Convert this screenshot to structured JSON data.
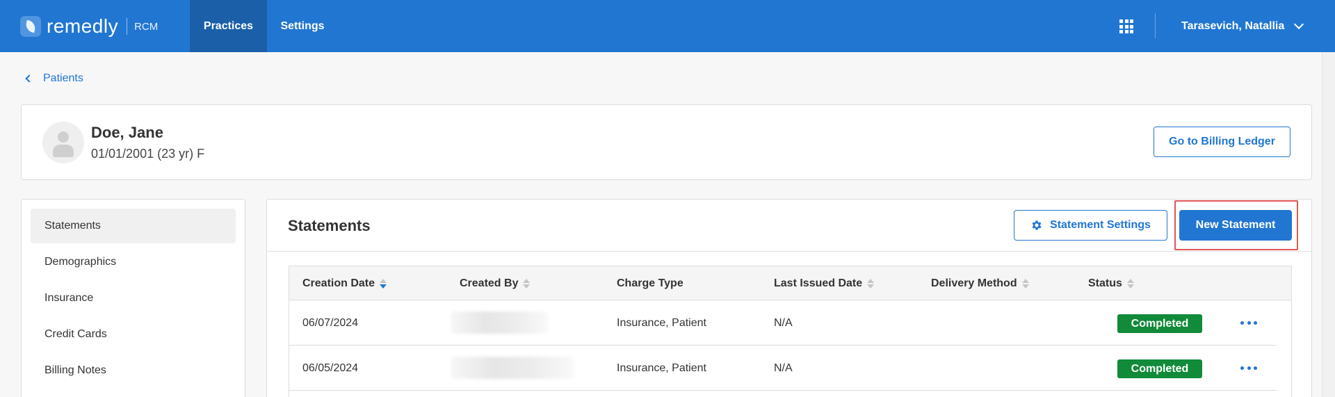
{
  "brand": {
    "name": "remedly",
    "product": "RCM"
  },
  "nav": {
    "tabs": [
      "Practices",
      "Settings"
    ],
    "active": "Practices",
    "user_name": "Tarasevich, Natallia"
  },
  "breadcrumb": {
    "back_label": "Patients"
  },
  "patient": {
    "name": "Doe, Jane",
    "details": "01/01/2001 (23 yr) F",
    "ledger_button": "Go to Billing Ledger"
  },
  "sidebar": {
    "items": [
      {
        "label": "Statements",
        "active": true
      },
      {
        "label": "Demographics"
      },
      {
        "label": "Insurance"
      },
      {
        "label": "Credit Cards"
      },
      {
        "label": "Billing Notes"
      }
    ]
  },
  "statements": {
    "title": "Statements",
    "settings_button": "Statement Settings",
    "new_button": "New Statement",
    "columns": [
      "Creation Date",
      "Created By",
      "Charge Type",
      "Last Issued Date",
      "Delivery Method",
      "Status"
    ],
    "rows": [
      {
        "creation_date": "06/07/2024",
        "created_by": "",
        "charge_type": "Insurance, Patient",
        "last_issued": "N/A",
        "delivery_method": "",
        "status": "Completed"
      },
      {
        "creation_date": "06/05/2024",
        "created_by": "",
        "charge_type": "Insurance, Patient",
        "last_issued": "N/A",
        "delivery_method": "",
        "status": "Completed"
      }
    ]
  },
  "colors": {
    "primary": "#2176d2",
    "nav_active": "#1a5fa8",
    "success": "#118a3a",
    "highlight": "#e05555"
  }
}
